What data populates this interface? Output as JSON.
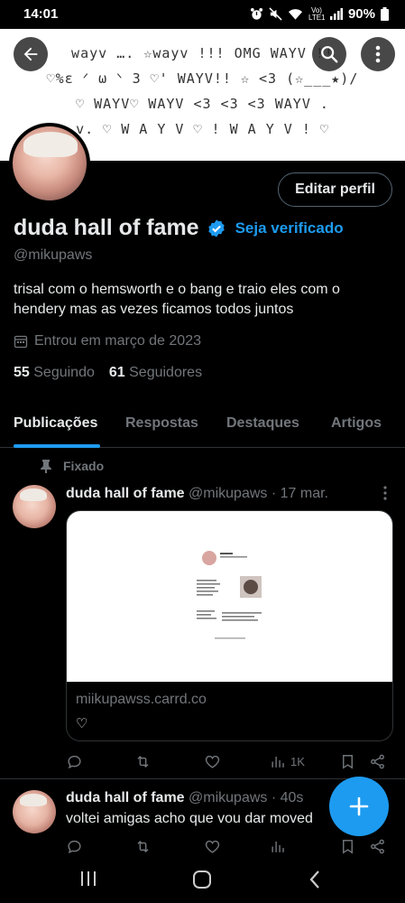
{
  "status_bar": {
    "time": "14:01",
    "network": "Vo) LTE1",
    "battery": "90%",
    "icons": [
      "alarm-icon",
      "mute-icon",
      "wifi-icon",
      "signal-icon",
      "battery-icon"
    ]
  },
  "banner": {
    "lines": [
      "wayv …. ☆wayv !!! OMG WAYV !!",
      "♡%ε ᐟ ω ᐠ 3 ♡' WAYV!! ☆ <3 (☆___★)/",
      "♡ WAYV♡ WAYV <3 <3 <3 WAYV .",
      "v. ♡ W A Y V ♡ ! W A Y V ! ♡"
    ]
  },
  "profile": {
    "edit_button": "Editar perfil",
    "name": "duda hall of fame",
    "verify_cta": "Seja verificado",
    "handle": "@mikupaws",
    "bio": "trisal com o hemsworth e o bang e traio eles com o hendery mas as vezes ficamos todos juntos",
    "joined": "Entrou em março de 2023",
    "following_count": "55",
    "following_label": "Seguindo",
    "followers_count": "61",
    "followers_label": "Seguidores"
  },
  "tabs": [
    "Publicações",
    "Respostas",
    "Destaques",
    "Artigos"
  ],
  "active_tab": "Publicações",
  "pinned_label": "Fixado",
  "tweets": [
    {
      "name": "duda hall of fame",
      "meta": "@mikupaws · 17 mar.",
      "card_domain": "miikupawss.carrd.co",
      "card_text": "♡",
      "views": "1K"
    },
    {
      "name": "duda hall of fame",
      "meta": "@mikupaws · 40s",
      "text": "voltei amigas acho que vou dar moved"
    }
  ],
  "colors": {
    "accent": "#1d9bf0",
    "background": "#000000",
    "text_primary": "#e7e9ea",
    "text_secondary": "#71767b",
    "border": "#2f3336"
  }
}
